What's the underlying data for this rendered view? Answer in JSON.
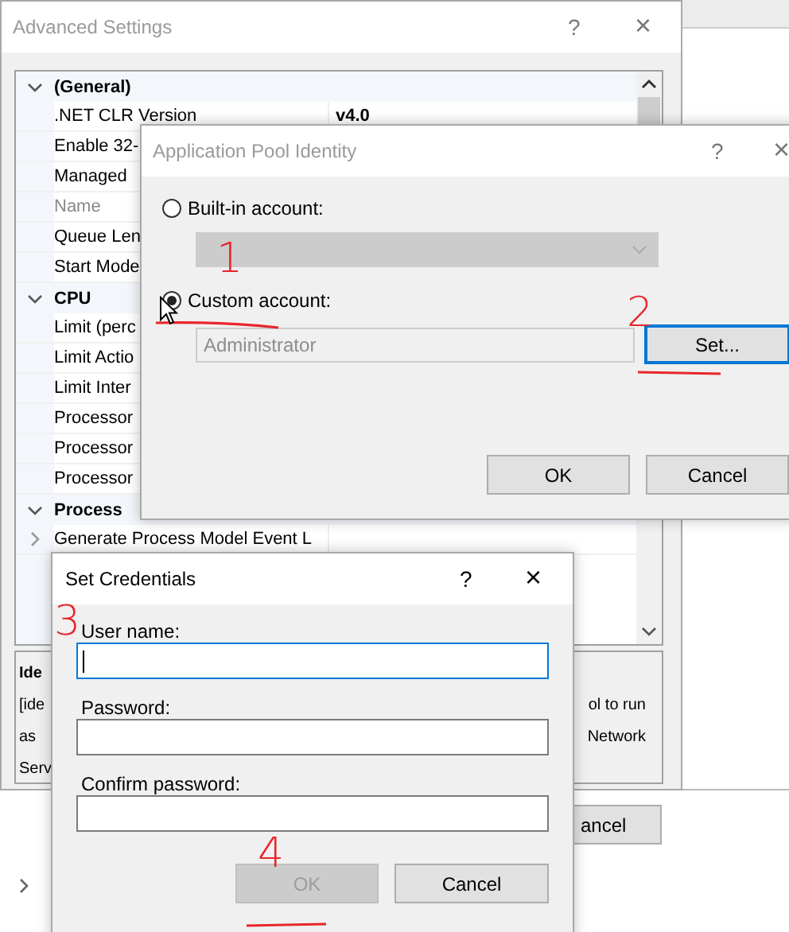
{
  "advanced_settings": {
    "title": "Advanced Settings",
    "active": false,
    "help": "?",
    "close": "×",
    "categories": [
      {
        "name": "(General)",
        "expanded": true,
        "children": [
          {
            "name": ".NET CLR Version",
            "value": "v4.0",
            "disabled": false
          },
          {
            "name": "Enable 32-",
            "disabled": false
          },
          {
            "name": "Managed",
            "disabled": false
          },
          {
            "name": "Name",
            "disabled": true
          },
          {
            "name": "Queue Len",
            "disabled": false
          },
          {
            "name": "Start Mode",
            "disabled": false
          }
        ]
      },
      {
        "name": "CPU",
        "expanded": true,
        "children": [
          {
            "name": "Limit (perc",
            "disabled": false
          },
          {
            "name": "Limit Actio",
            "disabled": false
          },
          {
            "name": "Limit Inter",
            "disabled": false
          },
          {
            "name": "Processor",
            "disabled": false
          },
          {
            "name": "Processor",
            "disabled": false
          },
          {
            "name": "Processor",
            "disabled": false
          }
        ]
      },
      {
        "name": "Process",
        "expanded": true,
        "children": [
          {
            "name": "Generate Process Model Event L",
            "disabled": false,
            "expanded": false
          }
        ]
      }
    ],
    "description": {
      "title": "Ide",
      "lines": [
        {
          "left": "[ide",
          "right": "ol to run"
        },
        {
          "left": "as",
          "right": "Network"
        },
        {
          "left": "Serv"
        }
      ]
    },
    "cancel_button": "ancel"
  },
  "app_pool_identity": {
    "title": "Application Pool Identity",
    "active": false,
    "help": "?",
    "close": "×",
    "options": [
      {
        "label": "Built-in account:",
        "selected": false
      },
      {
        "label": "Custom account:",
        "selected": true
      }
    ],
    "builtin_dropdown": {
      "disabled": true
    },
    "custom_account": {
      "value": "Administrator",
      "disabled": true
    },
    "set_button": {
      "label": "Set...",
      "focused": true
    },
    "buttons": [
      "OK",
      "Cancel"
    ]
  },
  "set_credentials": {
    "title": "Set Credentials",
    "active": true,
    "help": "?",
    "close": "×",
    "fields": [
      {
        "label": "User name:",
        "focused": true
      },
      {
        "label": "Password:",
        "focused": false
      },
      {
        "label": "Confirm password:",
        "focused": false
      }
    ],
    "ok_button": {
      "label": "OK",
      "disabled": true
    },
    "cancel_button": {
      "label": "Cancel",
      "disabled": false
    }
  },
  "annotations": [
    {
      "label": "1"
    },
    {
      "label": "2"
    },
    {
      "label": "3"
    },
    {
      "label": "4"
    }
  ]
}
